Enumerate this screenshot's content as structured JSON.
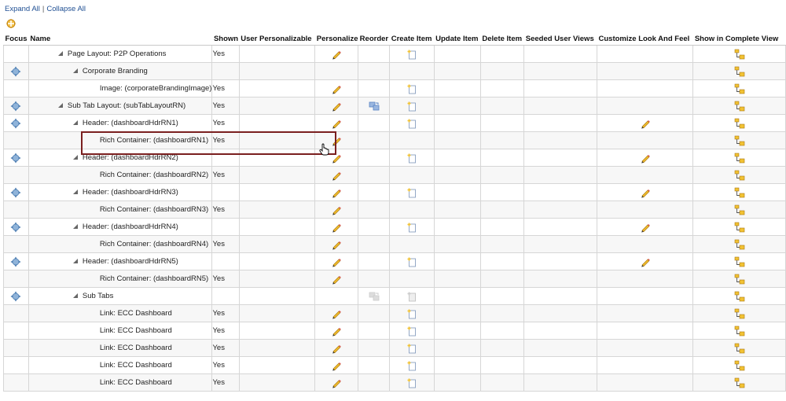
{
  "toplinks": {
    "expand_all": "Expand All",
    "separator": "|",
    "collapse_all": "Collapse All"
  },
  "columns": [
    "Focus",
    "Name",
    "Shown",
    "User Personalizable",
    "Personalize",
    "Reorder",
    "Create Item",
    "Update Item",
    "Delete Item",
    "Seeded User Views",
    "Customize Look And Feel",
    "Show in Complete View"
  ],
  "rows": [
    {
      "name": "Page Layout: P2P Operations",
      "shown": "Yes",
      "level": 1,
      "toggle": true,
      "focus": false,
      "personalize": true,
      "reorder": "",
      "create": "on",
      "laf": false
    },
    {
      "name": "Corporate Branding",
      "shown": "",
      "level": 2,
      "toggle": true,
      "focus": true,
      "personalize": false,
      "reorder": "",
      "create": "",
      "laf": false
    },
    {
      "name": "Image: (corporateBrandingImage)",
      "shown": "Yes",
      "level": 3,
      "toggle": false,
      "focus": false,
      "personalize": true,
      "reorder": "",
      "create": "on",
      "laf": false
    },
    {
      "name": "Sub Tab Layout: (subTabLayoutRN)",
      "shown": "Yes",
      "level": 1,
      "toggle": true,
      "focus": true,
      "personalize": true,
      "reorder": "on",
      "create": "on",
      "laf": false
    },
    {
      "name": "Header: (dashboardHdrRN1)",
      "shown": "Yes",
      "level": 2,
      "toggle": true,
      "focus": true,
      "personalize": true,
      "reorder": "",
      "create": "on",
      "laf": true
    },
    {
      "name": "Rich Container: (dashboardRN1)",
      "shown": "Yes",
      "level": 3,
      "toggle": false,
      "focus": false,
      "personalize": true,
      "reorder": "",
      "create": "",
      "laf": false
    },
    {
      "name": "Header: (dashboardHdrRN2)",
      "shown": "",
      "level": 2,
      "toggle": true,
      "focus": true,
      "personalize": true,
      "reorder": "",
      "create": "on",
      "laf": true
    },
    {
      "name": "Rich Container: (dashboardRN2)",
      "shown": "Yes",
      "level": 3,
      "toggle": false,
      "focus": false,
      "personalize": true,
      "reorder": "",
      "create": "",
      "laf": false
    },
    {
      "name": "Header: (dashboardHdrRN3)",
      "shown": "",
      "level": 2,
      "toggle": true,
      "focus": true,
      "personalize": true,
      "reorder": "",
      "create": "on",
      "laf": true
    },
    {
      "name": "Rich Container: (dashboardRN3)",
      "shown": "Yes",
      "level": 3,
      "toggle": false,
      "focus": false,
      "personalize": true,
      "reorder": "",
      "create": "",
      "laf": false
    },
    {
      "name": "Header: (dashboardHdrRN4)",
      "shown": "",
      "level": 2,
      "toggle": true,
      "focus": true,
      "personalize": true,
      "reorder": "",
      "create": "on",
      "laf": true
    },
    {
      "name": "Rich Container: (dashboardRN4)",
      "shown": "Yes",
      "level": 3,
      "toggle": false,
      "focus": false,
      "personalize": true,
      "reorder": "",
      "create": "",
      "laf": false
    },
    {
      "name": "Header: (dashboardHdrRN5)",
      "shown": "",
      "level": 2,
      "toggle": true,
      "focus": true,
      "personalize": true,
      "reorder": "",
      "create": "on",
      "laf": true
    },
    {
      "name": "Rich Container: (dashboardRN5)",
      "shown": "Yes",
      "level": 3,
      "toggle": false,
      "focus": false,
      "personalize": true,
      "reorder": "",
      "create": "",
      "laf": false
    },
    {
      "name": "Sub Tabs",
      "shown": "",
      "level": 2,
      "toggle": true,
      "focus": true,
      "personalize": false,
      "reorder": "off",
      "create": "off",
      "laf": false
    },
    {
      "name": "Link: ECC Dashboard",
      "shown": "Yes",
      "level": 3,
      "toggle": false,
      "focus": false,
      "personalize": true,
      "reorder": "",
      "create": "on",
      "laf": false
    },
    {
      "name": "Link: ECC Dashboard",
      "shown": "Yes",
      "level": 3,
      "toggle": false,
      "focus": false,
      "personalize": true,
      "reorder": "",
      "create": "on",
      "laf": false
    },
    {
      "name": "Link: ECC Dashboard",
      "shown": "Yes",
      "level": 3,
      "toggle": false,
      "focus": false,
      "personalize": true,
      "reorder": "",
      "create": "on",
      "laf": false
    },
    {
      "name": "Link: ECC Dashboard",
      "shown": "Yes",
      "level": 3,
      "toggle": false,
      "focus": false,
      "personalize": true,
      "reorder": "",
      "create": "on",
      "laf": false
    },
    {
      "name": "Link: ECC Dashboard",
      "shown": "Yes",
      "level": 3,
      "toggle": false,
      "focus": false,
      "personalize": true,
      "reorder": "",
      "create": "on",
      "laf": false
    }
  ],
  "icons": {
    "focus": "focus-crosshair-icon",
    "personalize": "pencil-icon",
    "reorder": "reorder-icon",
    "create": "create-item-icon",
    "laf": "pencil-icon",
    "complete_view": "show-complete-view-icon"
  },
  "colors": {
    "link": "#1f4f93",
    "highlight_border": "#7a1f1f",
    "pencil": "#e8b321"
  }
}
